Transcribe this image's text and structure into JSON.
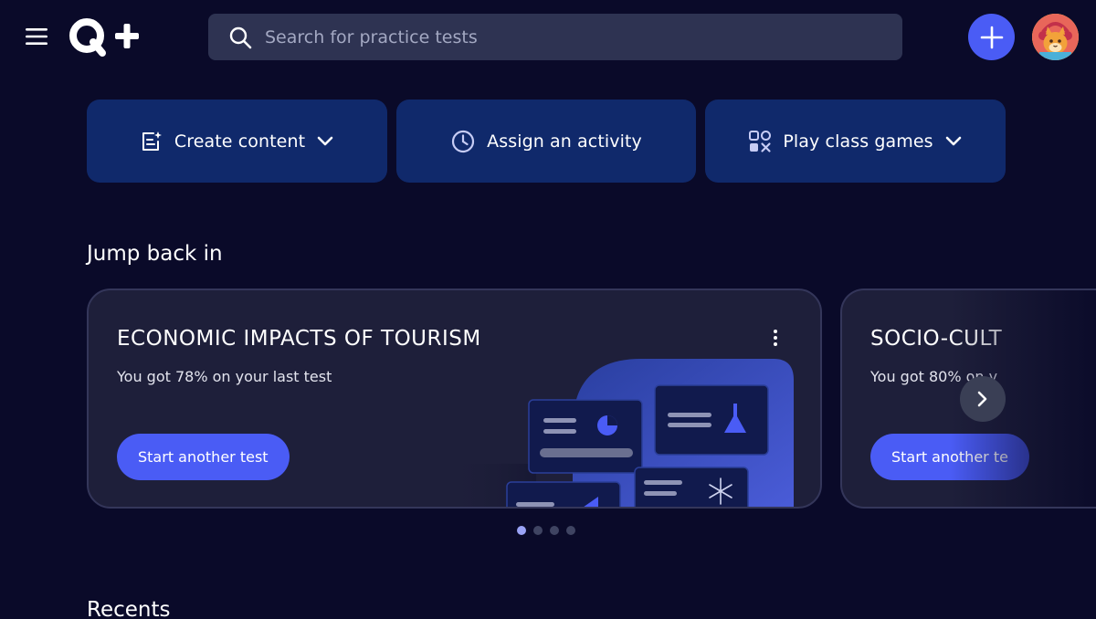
{
  "header": {
    "search_placeholder": "Search for practice tests",
    "add_icon": "plus-icon",
    "menu_icon": "hamburger-menu-icon",
    "search_icon": "search-icon"
  },
  "actions": [
    {
      "label": "Create content",
      "icon": "create-content-icon",
      "has_dropdown": true
    },
    {
      "label": "Assign an activity",
      "icon": "clock-icon",
      "has_dropdown": false
    },
    {
      "label": "Play class games",
      "icon": "class-games-icon",
      "has_dropdown": true
    }
  ],
  "jump_back_in": {
    "title": "Jump back in",
    "cards": [
      {
        "title": "ECONOMIC IMPACTS OF TOURISM",
        "subtitle": "You got 78% on your last test",
        "button": "Start another test"
      },
      {
        "title": "SOCIO-CULT",
        "subtitle": "You got 80% on y",
        "button": "Start another te"
      }
    ],
    "pagination": {
      "count": 4,
      "active": 0
    }
  },
  "recents": {
    "title": "Recents"
  },
  "colors": {
    "background": "#0a0a29",
    "accent": "#4a5cf5",
    "action_bg": "#10296b",
    "card_bg": "#1e1f3a"
  }
}
